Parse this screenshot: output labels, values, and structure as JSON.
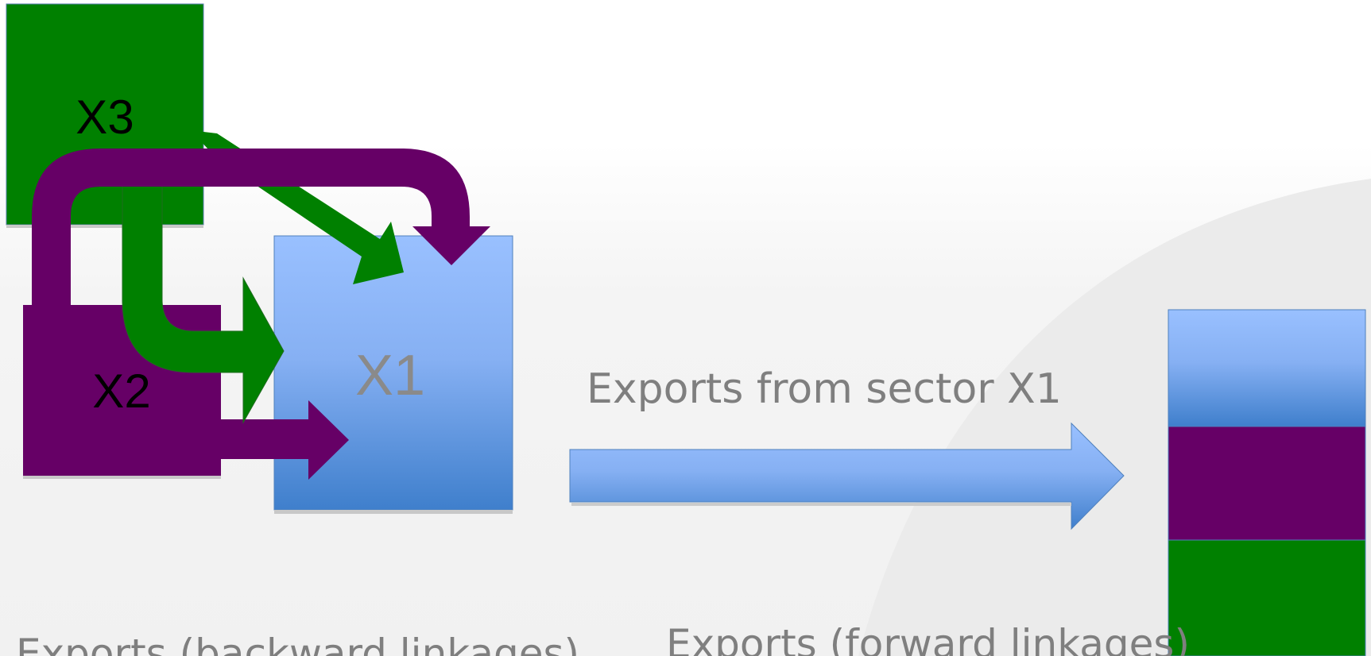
{
  "slide": {
    "background": "#f2f2f2",
    "colors": {
      "green": "#008000",
      "purple": "#660066",
      "blue_light": "#99c0ff",
      "blue_dark": "#3f7fcc",
      "label_gray": "#7f7f7f"
    }
  },
  "nodes": {
    "x3": {
      "label": "X3"
    },
    "x2": {
      "label": "X2"
    },
    "x1": {
      "label": "X1"
    }
  },
  "labels": {
    "exports_from_sector": "Exports from sector X1",
    "backward": "Exports (backward linkages)",
    "forward": "Exports (forward linkages)"
  },
  "stacked_bar": {
    "segments": [
      {
        "name": "x1-segment",
        "color": "blue"
      },
      {
        "name": "x2-segment",
        "color": "purple"
      },
      {
        "name": "x3-segment",
        "color": "green"
      }
    ]
  }
}
